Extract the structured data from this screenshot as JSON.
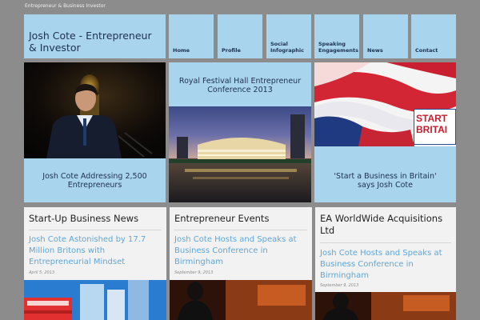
{
  "header": {
    "tagline": "Entrepreneur & Business Investor",
    "site_title": "Josh Cote - Entrepreneur & Investor"
  },
  "nav": {
    "items": [
      {
        "label": "Home"
      },
      {
        "label": "Profile"
      },
      {
        "label": "Social Infographic"
      },
      {
        "label": "Speaking Engagements"
      },
      {
        "label": "News"
      },
      {
        "label": "Contact"
      }
    ]
  },
  "featured": {
    "left_caption": "Josh Cote Addressing 2,500 Entrepreneurs",
    "center_title": "Royal Festival Hall Entrepreneur Conference 2013",
    "right_caption": "'Start a Business in Britain' says Josh Cote",
    "right_image_text": "START BRITAI"
  },
  "columns": [
    {
      "heading": "Start-Up Business News",
      "post_title": "Josh Cote Astonished by 17.7 Million Britons with Entrepreneurial Mindset",
      "date": "April 5, 2013"
    },
    {
      "heading": "Entrepreneur Events",
      "post_title": "Josh Cote Hosts and Speaks at Business Conference in Birmingham",
      "date": "September 9, 2013"
    },
    {
      "heading": "EA WorldWide Acquisitions Ltd",
      "post_title": "Josh Cote Hosts and Speaks at Business Conference in Birmingham",
      "date": "September 9, 2013"
    }
  ],
  "colors": {
    "tile_blue": "#a9d4ee",
    "link_blue": "#5fa6d8",
    "text_navy": "#1d3150",
    "page_gray": "#8c8c8c"
  }
}
